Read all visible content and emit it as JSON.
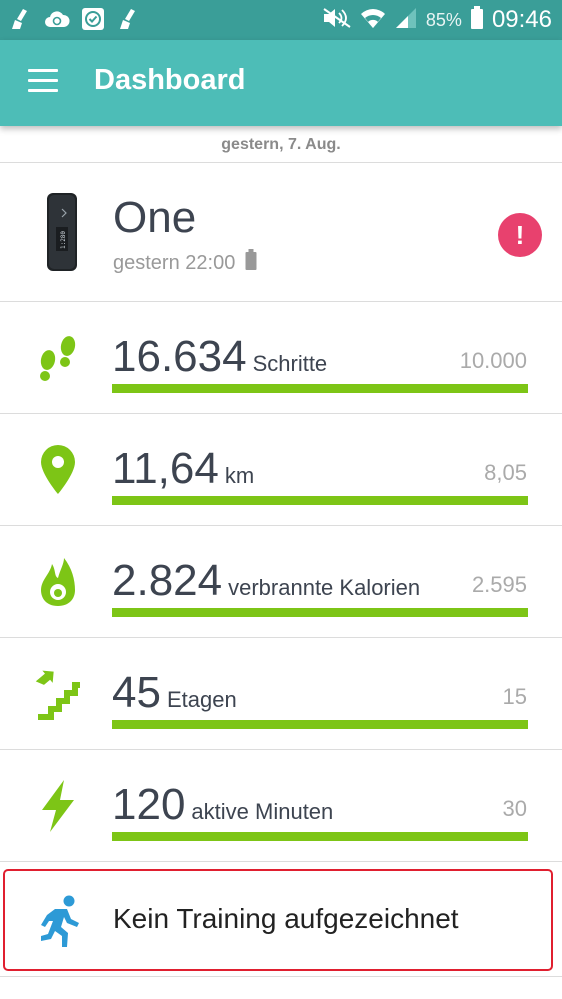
{
  "status_bar": {
    "notification_icons": [
      "broom-icon",
      "cloud-sync-icon",
      "checkbox-icon",
      "broom-icon"
    ],
    "battery_percent": "85%",
    "time": "09:46"
  },
  "app_bar": {
    "title": "Dashboard"
  },
  "date_label": "gestern, 7. Aug.",
  "device": {
    "name": "One",
    "last_sync": "gestern 22:00",
    "alert_symbol": "!"
  },
  "stats": [
    {
      "icon": "footsteps-icon",
      "value": "16.634",
      "unit": "Schritte",
      "goal": "10.000",
      "progress": 1.0
    },
    {
      "icon": "location-pin-icon",
      "value": "11,64",
      "unit": "km",
      "goal": "8,05",
      "progress": 1.0
    },
    {
      "icon": "flame-icon",
      "value": "2.824",
      "unit": "verbrannte Kalorien",
      "goal": "2.595",
      "progress": 1.0
    },
    {
      "icon": "stairs-icon",
      "value": "45",
      "unit": "Etagen",
      "goal": "15",
      "progress": 1.0
    },
    {
      "icon": "lightning-icon",
      "value": "120",
      "unit": "aktive Minuten",
      "goal": "30",
      "progress": 1.0
    }
  ],
  "training": {
    "icon": "runner-icon",
    "label": "Kein Training aufgezeichnet"
  },
  "colors": {
    "status_bar": "#3a9e98",
    "app_bar": "#4dbdb7",
    "accent_green": "#7dc516",
    "alert_pink": "#e8416e",
    "runner_blue": "#2d9ad6",
    "highlight_red": "#e01f2f"
  }
}
